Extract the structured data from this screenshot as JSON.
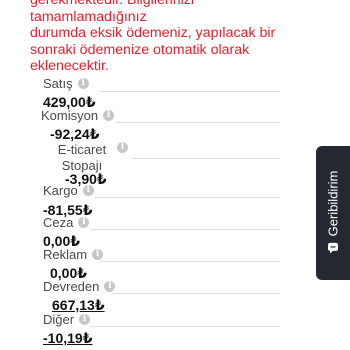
{
  "warning": {
    "lines": [
      "gerekmektedir. Bilgilerinizi tamamlamadığınız",
      "durumda eksik ödemeniz, yapılacak bir",
      "sonraki ödemenize otomatik olarak",
      "eklenecektir."
    ]
  },
  "breakdown": {
    "satis": {
      "label": "Satış",
      "value": "429,00₺"
    },
    "komisyon": {
      "label": "Komisyon",
      "value": "-92,24₺"
    },
    "eticaret": {
      "label_line1": "E-ticaret",
      "label_line2": "Stopajı",
      "value": "-3,90₺"
    },
    "kargo": {
      "label": "Kargo",
      "value": "-81,55₺"
    },
    "ceza": {
      "label": "Ceza",
      "value": "0,00₺"
    },
    "reklam": {
      "label": "Reklam",
      "value": "0,00₺"
    },
    "devreden": {
      "label": "Devreden",
      "value": "667,13₺"
    },
    "diger": {
      "label": "Diğer",
      "value": "-10,19₺"
    }
  },
  "feedback": {
    "label": "Geribildirim"
  },
  "icons": {
    "info": "info-icon",
    "feedback": "chat-icon"
  }
}
